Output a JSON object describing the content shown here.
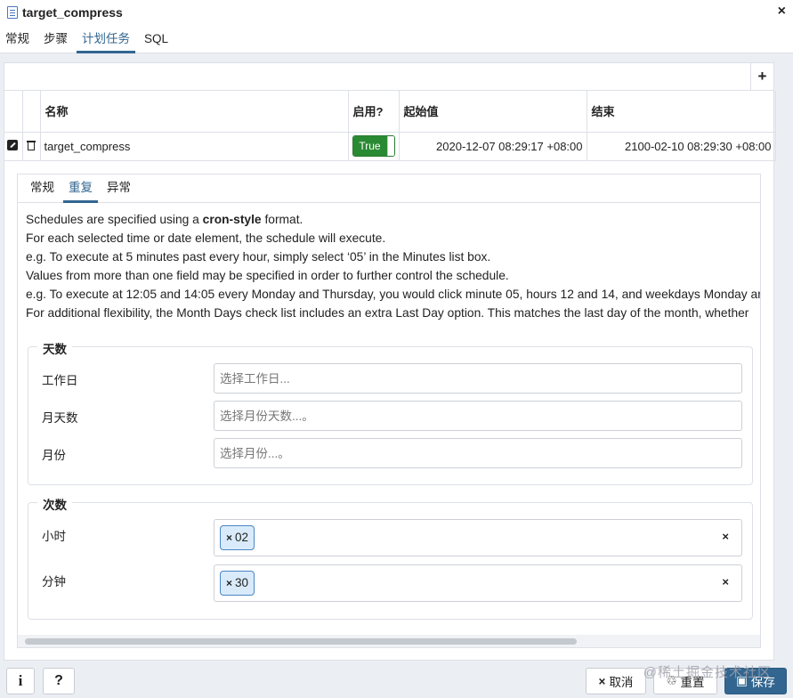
{
  "window": {
    "title": "target_compress",
    "close_glyph": "×"
  },
  "main_tabs": [
    "常规",
    "步骤",
    "计划任务",
    "SQL"
  ],
  "toolbar": {
    "add_glyph": "+"
  },
  "grid": {
    "headers": {
      "name": "名称",
      "enabled": "启用?",
      "start": "起始值",
      "end": "结束"
    },
    "row": {
      "name": "target_compress",
      "enabled": "True",
      "start": "2020-12-07 08:29:17 +08:00",
      "end": "2100-02-10 08:29:30 +08:00"
    }
  },
  "sub_tabs": [
    "常规",
    "重复",
    "异常"
  ],
  "help": {
    "line1_pre": "Schedules are specified using a ",
    "line1_bold": "cron-style",
    "line1_post": " format.",
    "line2": "For each selected time or date element, the schedule will execute.",
    "line3": "e.g. To execute at 5 minutes past every hour, simply select ‘05’ in the Minutes list box.",
    "line4": "Values from more than one field may be specified in order to further control the schedule.",
    "line5": "e.g. To execute at 12:05 and 14:05 every Monday and Thursday, you would click minute 05, hours 12 and 14, and weekdays Monday ar",
    "line6": "For additional flexibility, the Month Days check list includes an extra Last Day option. This matches the last day of the month, whether"
  },
  "days": {
    "legend": "天数",
    "weekday": {
      "label": "工作日",
      "placeholder": "选择工作日..."
    },
    "monthday": {
      "label": "月天数",
      "placeholder": "选择月份天数...。"
    },
    "month": {
      "label": "月份",
      "placeholder": "选择月份...。"
    }
  },
  "times": {
    "legend": "次数",
    "hours": {
      "label": "小时",
      "tag_x": "×",
      "tag": "02",
      "clear": "×"
    },
    "minutes": {
      "label": "分钟",
      "tag_x": "×",
      "tag": "30",
      "clear": "×"
    }
  },
  "footer": {
    "info": "i",
    "help": "?",
    "cancel_icon": "×",
    "cancel": "取消",
    "reset_icon": "♲",
    "reset": "重置",
    "save": "保存"
  },
  "watermark": "@稀土掘金技术社区",
  "colors": {
    "accent": "#326690",
    "enabled_green": "#2a8a33",
    "tag_bg": "#d9ebfa"
  }
}
